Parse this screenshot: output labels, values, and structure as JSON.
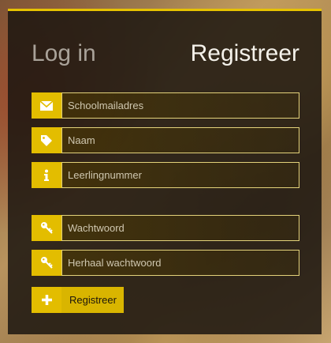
{
  "tabs": {
    "login_label": "Log in",
    "register_label": "Registreer"
  },
  "form": {
    "fields": [
      {
        "name": "email",
        "icon": "envelope-icon",
        "placeholder": "Schoolmailadres",
        "value": ""
      },
      {
        "name": "name",
        "icon": "tag-icon",
        "placeholder": "Naam",
        "value": ""
      },
      {
        "name": "student_number",
        "icon": "info-icon",
        "placeholder": "Leerlingnummer",
        "value": ""
      },
      {
        "name": "password",
        "icon": "key-icon",
        "placeholder": "Wachtwoord",
        "value": ""
      },
      {
        "name": "password_repeat",
        "icon": "key-icon",
        "placeholder": "Herhaal wachtwoord",
        "value": ""
      }
    ],
    "submit": {
      "icon": "plus-icon",
      "label": "Registreer"
    }
  },
  "colors": {
    "accent": "#e3bd00",
    "panel": "#1c1610",
    "active_tab": "#f4f1ea",
    "inactive_tab": "#a9a299"
  }
}
